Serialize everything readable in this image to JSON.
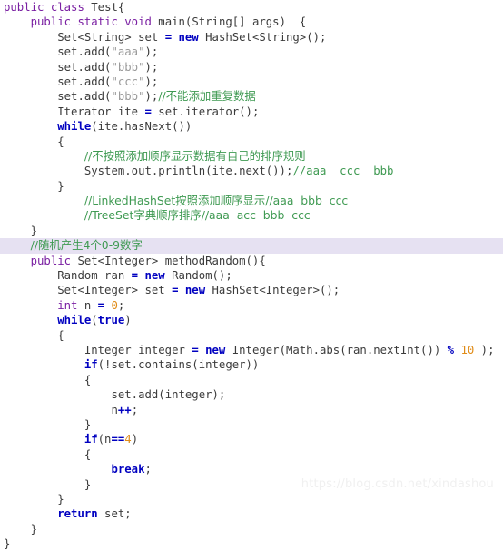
{
  "editor": {
    "language": "java",
    "background_color": "#ffffff",
    "highlight_color": "#e6e1f2",
    "colors": {
      "keyword_purple": "#7a1fa2",
      "keyword_blue": "#0000c0",
      "comment_green": "#3f9a52",
      "string_gray": "#9a9a9a",
      "number_orange": "#e08c18",
      "plain_text": "#3b3b3b"
    }
  },
  "watermark": {
    "text": "https://blog.csdn.net/xindashou"
  },
  "code": {
    "lines": [
      {
        "indent": 0,
        "highlight": false,
        "tokens": [
          {
            "t": "public",
            "c": "kw"
          },
          {
            "t": " ",
            "c": "plain"
          },
          {
            "t": "class",
            "c": "kw"
          },
          {
            "t": " Test{",
            "c": "plain"
          }
        ]
      },
      {
        "indent": 1,
        "highlight": false,
        "tokens": [
          {
            "t": "public",
            "c": "kw"
          },
          {
            "t": " ",
            "c": "plain"
          },
          {
            "t": "static",
            "c": "kw"
          },
          {
            "t": " ",
            "c": "plain"
          },
          {
            "t": "void",
            "c": "kw"
          },
          {
            "t": " main(String[] args)  {",
            "c": "plain"
          }
        ]
      },
      {
        "indent": 2,
        "highlight": false,
        "tokens": [
          {
            "t": "Set<String> set ",
            "c": "plain"
          },
          {
            "t": "=",
            "c": "op"
          },
          {
            "t": " ",
            "c": "plain"
          },
          {
            "t": "new",
            "c": "kw-blue"
          },
          {
            "t": " HashSet<String>();",
            "c": "plain"
          }
        ]
      },
      {
        "indent": 2,
        "highlight": false,
        "tokens": [
          {
            "t": "set.add(",
            "c": "plain"
          },
          {
            "t": "\"aaa\"",
            "c": "str"
          },
          {
            "t": ");",
            "c": "plain"
          }
        ]
      },
      {
        "indent": 2,
        "highlight": false,
        "tokens": [
          {
            "t": "set.add(",
            "c": "plain"
          },
          {
            "t": "\"bbb\"",
            "c": "str"
          },
          {
            "t": ");",
            "c": "plain"
          }
        ]
      },
      {
        "indent": 2,
        "highlight": false,
        "tokens": [
          {
            "t": "set.add(",
            "c": "plain"
          },
          {
            "t": "\"ccc\"",
            "c": "str"
          },
          {
            "t": ");",
            "c": "plain"
          }
        ]
      },
      {
        "indent": 2,
        "highlight": false,
        "tokens": [
          {
            "t": "set.add(",
            "c": "plain"
          },
          {
            "t": "\"bbb\"",
            "c": "str"
          },
          {
            "t": ");",
            "c": "plain"
          },
          {
            "t": "//不能添加重复数据",
            "c": "cmt-cn"
          }
        ]
      },
      {
        "indent": 2,
        "highlight": false,
        "tokens": [
          {
            "t": "Iterator ite ",
            "c": "plain"
          },
          {
            "t": "=",
            "c": "op"
          },
          {
            "t": " set.iterator();",
            "c": "plain"
          }
        ]
      },
      {
        "indent": 2,
        "highlight": false,
        "tokens": [
          {
            "t": "while",
            "c": "kw-blue"
          },
          {
            "t": "(ite.hasNext())",
            "c": "plain"
          }
        ]
      },
      {
        "indent": 2,
        "highlight": false,
        "tokens": [
          {
            "t": "{",
            "c": "plain"
          }
        ]
      },
      {
        "indent": 3,
        "highlight": false,
        "tokens": [
          {
            "t": "//不按照添加顺序显示数据有自己的排序规则",
            "c": "cmt-cn"
          }
        ]
      },
      {
        "indent": 3,
        "highlight": false,
        "tokens": [
          {
            "t": "System.out.println(ite.next());",
            "c": "plain"
          },
          {
            "t": "//aaa  ccc  bbb",
            "c": "cmt"
          }
        ]
      },
      {
        "indent": 2,
        "highlight": false,
        "tokens": [
          {
            "t": "}",
            "c": "plain"
          }
        ]
      },
      {
        "indent": 3,
        "highlight": false,
        "tokens": [
          {
            "t": "//LinkedHashSet按照添加顺序显示//aaa  bbb  ccc",
            "c": "cmt-cn"
          }
        ]
      },
      {
        "indent": 3,
        "highlight": false,
        "tokens": [
          {
            "t": "//TreeSet字典顺序排序//aaa  acc  bbb  ccc",
            "c": "cmt-cn"
          }
        ]
      },
      {
        "indent": 1,
        "highlight": false,
        "tokens": [
          {
            "t": "}",
            "c": "plain"
          }
        ]
      },
      {
        "indent": 1,
        "highlight": true,
        "tokens": [
          {
            "t": "//随机产生4个0-9数字",
            "c": "cmt-cn"
          }
        ]
      },
      {
        "indent": 1,
        "highlight": false,
        "tokens": [
          {
            "t": "public",
            "c": "kw"
          },
          {
            "t": " Set<Integer> methodRandom(){",
            "c": "plain"
          }
        ]
      },
      {
        "indent": 2,
        "highlight": false,
        "tokens": [
          {
            "t": "Random ran ",
            "c": "plain"
          },
          {
            "t": "=",
            "c": "op"
          },
          {
            "t": " ",
            "c": "plain"
          },
          {
            "t": "new",
            "c": "kw-blue"
          },
          {
            "t": " Random();",
            "c": "plain"
          }
        ]
      },
      {
        "indent": 2,
        "highlight": false,
        "tokens": [
          {
            "t": "Set<Integer> set ",
            "c": "plain"
          },
          {
            "t": "=",
            "c": "op"
          },
          {
            "t": " ",
            "c": "plain"
          },
          {
            "t": "new",
            "c": "kw-blue"
          },
          {
            "t": " HashSet<Integer>();",
            "c": "plain"
          }
        ]
      },
      {
        "indent": 2,
        "highlight": false,
        "tokens": [
          {
            "t": "int",
            "c": "kw"
          },
          {
            "t": " n ",
            "c": "plain"
          },
          {
            "t": "=",
            "c": "op"
          },
          {
            "t": " ",
            "c": "plain"
          },
          {
            "t": "0",
            "c": "num"
          },
          {
            "t": ";",
            "c": "plain"
          }
        ]
      },
      {
        "indent": 2,
        "highlight": false,
        "tokens": [
          {
            "t": "while",
            "c": "kw-blue"
          },
          {
            "t": "(",
            "c": "plain"
          },
          {
            "t": "true",
            "c": "kw-blue"
          },
          {
            "t": ")",
            "c": "plain"
          }
        ]
      },
      {
        "indent": 2,
        "highlight": false,
        "tokens": [
          {
            "t": "{",
            "c": "plain"
          }
        ]
      },
      {
        "indent": 3,
        "highlight": false,
        "tokens": [
          {
            "t": "Integer integer ",
            "c": "plain"
          },
          {
            "t": "=",
            "c": "op"
          },
          {
            "t": " ",
            "c": "plain"
          },
          {
            "t": "new",
            "c": "kw-blue"
          },
          {
            "t": " Integer(Math.abs(ran.nextInt()) ",
            "c": "plain"
          },
          {
            "t": "%",
            "c": "op"
          },
          {
            "t": " ",
            "c": "plain"
          },
          {
            "t": "10",
            "c": "num"
          },
          {
            "t": " );",
            "c": "plain"
          }
        ]
      },
      {
        "indent": 3,
        "highlight": false,
        "tokens": [
          {
            "t": "if",
            "c": "kw-blue"
          },
          {
            "t": "(!set.contains(integer))",
            "c": "plain"
          }
        ]
      },
      {
        "indent": 3,
        "highlight": false,
        "tokens": [
          {
            "t": "{",
            "c": "plain"
          }
        ]
      },
      {
        "indent": 4,
        "highlight": false,
        "tokens": [
          {
            "t": "set.add(integer);",
            "c": "plain"
          }
        ]
      },
      {
        "indent": 4,
        "highlight": false,
        "tokens": [
          {
            "t": "n",
            "c": "plain"
          },
          {
            "t": "++",
            "c": "op"
          },
          {
            "t": ";",
            "c": "plain"
          }
        ]
      },
      {
        "indent": 3,
        "highlight": false,
        "tokens": [
          {
            "t": "}",
            "c": "plain"
          }
        ]
      },
      {
        "indent": 3,
        "highlight": false,
        "tokens": [
          {
            "t": "if",
            "c": "kw-blue"
          },
          {
            "t": "(n",
            "c": "plain"
          },
          {
            "t": "==",
            "c": "op"
          },
          {
            "t": "4",
            "c": "num"
          },
          {
            "t": ")",
            "c": "plain"
          }
        ]
      },
      {
        "indent": 3,
        "highlight": false,
        "tokens": [
          {
            "t": "{",
            "c": "plain"
          }
        ]
      },
      {
        "indent": 4,
        "highlight": false,
        "tokens": [
          {
            "t": "break",
            "c": "kw-blue"
          },
          {
            "t": ";",
            "c": "plain"
          }
        ]
      },
      {
        "indent": 3,
        "highlight": false,
        "tokens": [
          {
            "t": "}",
            "c": "plain"
          }
        ]
      },
      {
        "indent": 2,
        "highlight": false,
        "tokens": [
          {
            "t": "}",
            "c": "plain"
          }
        ]
      },
      {
        "indent": 2,
        "highlight": false,
        "tokens": [
          {
            "t": "return",
            "c": "kw-blue"
          },
          {
            "t": " set;",
            "c": "plain"
          }
        ]
      },
      {
        "indent": 1,
        "highlight": false,
        "tokens": [
          {
            "t": "}",
            "c": "plain"
          }
        ]
      },
      {
        "indent": 0,
        "highlight": false,
        "tokens": [
          {
            "t": "}",
            "c": "plain"
          }
        ]
      }
    ]
  }
}
